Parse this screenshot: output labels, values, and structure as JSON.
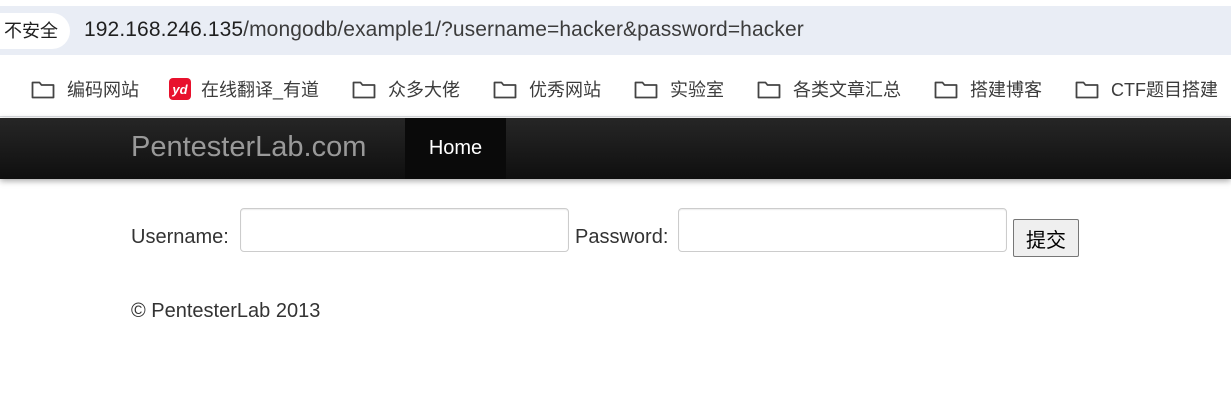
{
  "browser": {
    "security_label": "不安全",
    "url_host": "192.168.246.135",
    "url_rest": "/mongodb/example1/?username=hacker&password=hacker"
  },
  "bookmarks": [
    {
      "label": "编码网站",
      "icon": "folder-icon"
    },
    {
      "label": "在线翻译_有道",
      "icon": "youdao-icon",
      "icon_text": "yd"
    },
    {
      "label": "众多大佬",
      "icon": "folder-icon"
    },
    {
      "label": "优秀网站",
      "icon": "folder-icon"
    },
    {
      "label": "实验室",
      "icon": "folder-icon"
    },
    {
      "label": "各类文章汇总",
      "icon": "folder-icon"
    },
    {
      "label": "搭建博客",
      "icon": "folder-icon"
    },
    {
      "label": "CTF题目搭建",
      "icon": "folder-icon"
    }
  ],
  "navbar": {
    "brand": "PentesterLab.com",
    "home": "Home"
  },
  "form": {
    "username_label": "Username:",
    "username_value": "",
    "password_label": "Password:",
    "password_value": "",
    "submit_label": "提交"
  },
  "footer": {
    "text": "© PentesterLab 2013"
  },
  "colors": {
    "navbar_dark": "#1a1a1a",
    "brand_gray": "#999999",
    "address_bg": "#e9edf5",
    "youdao_red": "#e8112d"
  }
}
